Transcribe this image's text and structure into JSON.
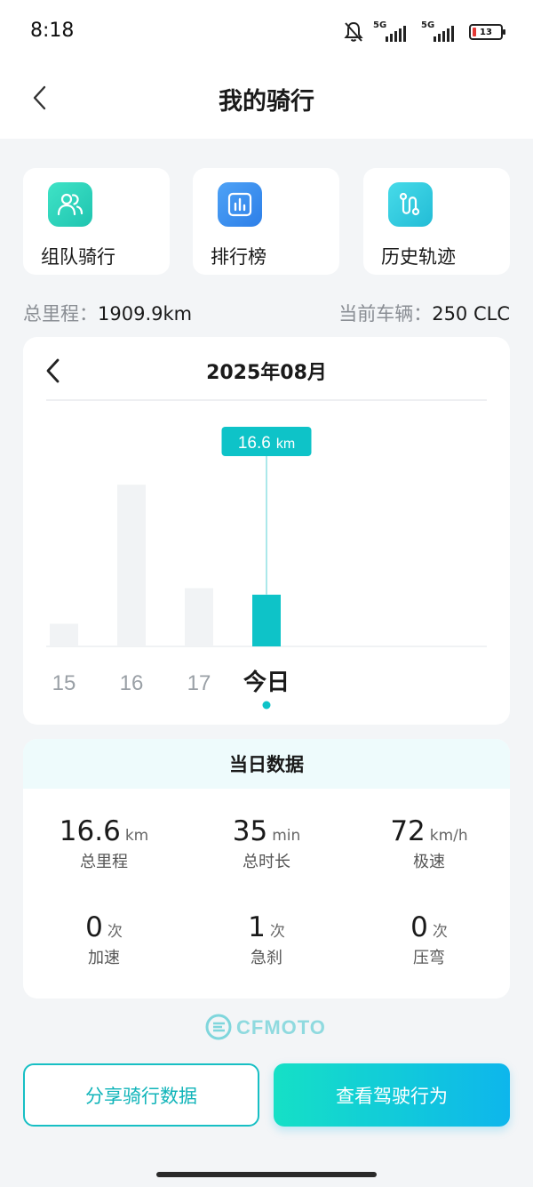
{
  "status": {
    "time": "8:18",
    "network_1": "5G",
    "network_2": "5G",
    "battery_level": "13"
  },
  "header": {
    "title": "我的骑行"
  },
  "quick_actions": [
    {
      "label": "组队骑行",
      "icon": "team-ride-icon",
      "color": "#2fd6b8"
    },
    {
      "label": "排行榜",
      "icon": "leaderboard-icon",
      "color": "#3a8ef0"
    },
    {
      "label": "历史轨迹",
      "icon": "track-history-icon",
      "color": "#2ec8dc"
    }
  ],
  "summary": {
    "total_label": "总里程：",
    "total_value": "1909.9km",
    "vehicle_label": "当前车辆：",
    "vehicle_value": "250 CLC"
  },
  "chart": {
    "month_label": "2025年08月",
    "tooltip_value": "16.6",
    "tooltip_unit": "km"
  },
  "chart_data": {
    "type": "bar",
    "categories": [
      "15",
      "16",
      "17",
      "今日"
    ],
    "values": [
      3.5,
      25,
      9,
      8
    ],
    "selected_index": 3,
    "ylim": [
      0,
      33
    ],
    "grid": false,
    "colors": {
      "default": "#f1f3f5",
      "selected": "#0ec3c8"
    }
  },
  "daily": {
    "title": "当日数据",
    "stats": [
      {
        "value": "16.6",
        "unit": "km",
        "label": "总里程"
      },
      {
        "value": "35",
        "unit": "min",
        "label": "总时长"
      },
      {
        "value": "72",
        "unit": "km/h",
        "label": "极速"
      },
      {
        "value": "0",
        "unit": "次",
        "label": "加速"
      },
      {
        "value": "1",
        "unit": "次",
        "label": "急刹"
      },
      {
        "value": "0",
        "unit": "次",
        "label": "压弯"
      }
    ]
  },
  "brand": {
    "name": "CFMOTO"
  },
  "buttons": {
    "share": "分享骑行数据",
    "drive": "查看驾驶行为"
  },
  "colors": {
    "accent": "#0ec3c8",
    "accent_dark": "#10b4b9"
  }
}
